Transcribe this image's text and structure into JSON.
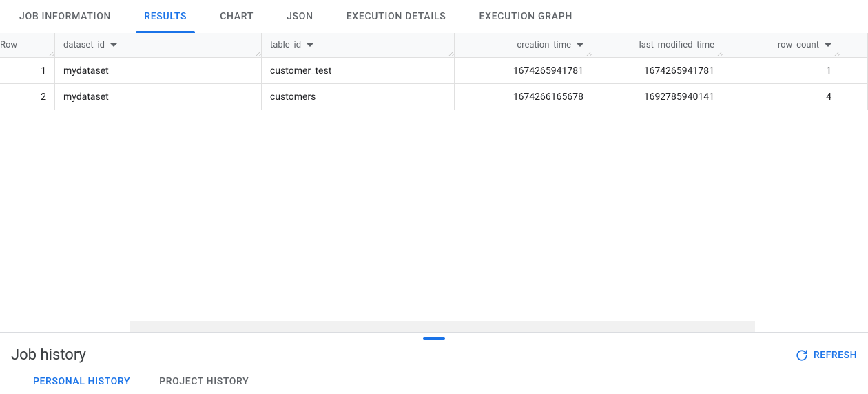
{
  "tabs": {
    "job_information": "JOB INFORMATION",
    "results": "RESULTS",
    "chart": "CHART",
    "json": "JSON",
    "execution_details": "EXECUTION DETAILS",
    "execution_graph": "EXECUTION GRAPH"
  },
  "columns": {
    "row": "Row",
    "dataset_id": "dataset_id",
    "table_id": "table_id",
    "creation_time": "creation_time",
    "last_modified_time": "last_modified_time",
    "row_count": "row_count"
  },
  "rows": [
    {
      "n": "1",
      "dataset_id": "mydataset",
      "table_id": "customer_test",
      "creation_time": "1674265941781",
      "last_modified_time": "1674265941781",
      "row_count": "1"
    },
    {
      "n": "2",
      "dataset_id": "mydataset",
      "table_id": "customers",
      "creation_time": "1674266165678",
      "last_modified_time": "1692785940141",
      "row_count": "4"
    }
  ],
  "bottom": {
    "title": "Job history",
    "refresh": "REFRESH",
    "tabs": {
      "personal": "PERSONAL HISTORY",
      "project": "PROJECT HISTORY"
    }
  }
}
